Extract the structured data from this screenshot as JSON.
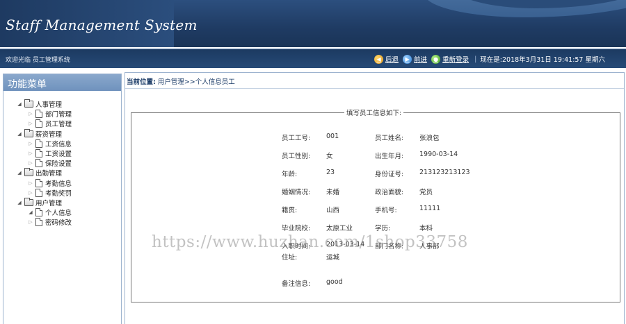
{
  "header": {
    "title": "Staff Management System"
  },
  "infobar": {
    "welcome": "欢迎光临 员工管理系统",
    "back": "后退",
    "forward": "前进",
    "relogin": "重新登录",
    "now_label": "现在是:2018年3月31日 19:41:57 星期六"
  },
  "sidebar": {
    "title": "功能菜单",
    "groups": [
      {
        "label": "人事管理",
        "items": [
          "部门管理",
          "员工管理"
        ]
      },
      {
        "label": "薪资管理",
        "items": [
          "工资信息",
          "工资设置",
          "保险设置"
        ]
      },
      {
        "label": "出勤管理",
        "items": [
          "考勤信息",
          "考勤奖罚"
        ]
      },
      {
        "label": "用户管理",
        "items": [
          "个人信息",
          "密码修改"
        ]
      }
    ]
  },
  "main": {
    "breadcrumb_label": "当前位置:",
    "breadcrumb_path": "用户管理>>个人信息员工",
    "form_title": "填写员工信息如下:",
    "fields": [
      {
        "l1": "员工工号:",
        "v1": "001",
        "l2": "员工姓名:",
        "v2": "张浪包"
      },
      {
        "l1": "员工性别:",
        "v1": "女",
        "l2": "出生年月:",
        "v2": "1990-03-14"
      },
      {
        "l1": "年龄:",
        "v1": "23",
        "l2": "身份证号:",
        "v2": "213123213123"
      },
      {
        "l1": "婚姻情况:",
        "v1": "未婚",
        "l2": "政治面貌:",
        "v2": "党员"
      },
      {
        "l1": "籍贯:",
        "v1": "山西",
        "l2": "手机号:",
        "v2": "11111"
      },
      {
        "l1": "毕业院校:",
        "v1": "太原工业",
        "l2": "学历:",
        "v2": "本科"
      },
      {
        "l1": "入职时间:",
        "v1": "2013-03-14",
        "l2": "部门名称:",
        "v2": "人事部"
      }
    ],
    "address_label": "住址:",
    "address_value": "运城",
    "note_label": "备注信息:",
    "note_value": "good"
  },
  "watermark": "https://www.huzhan.com/1shop33758"
}
